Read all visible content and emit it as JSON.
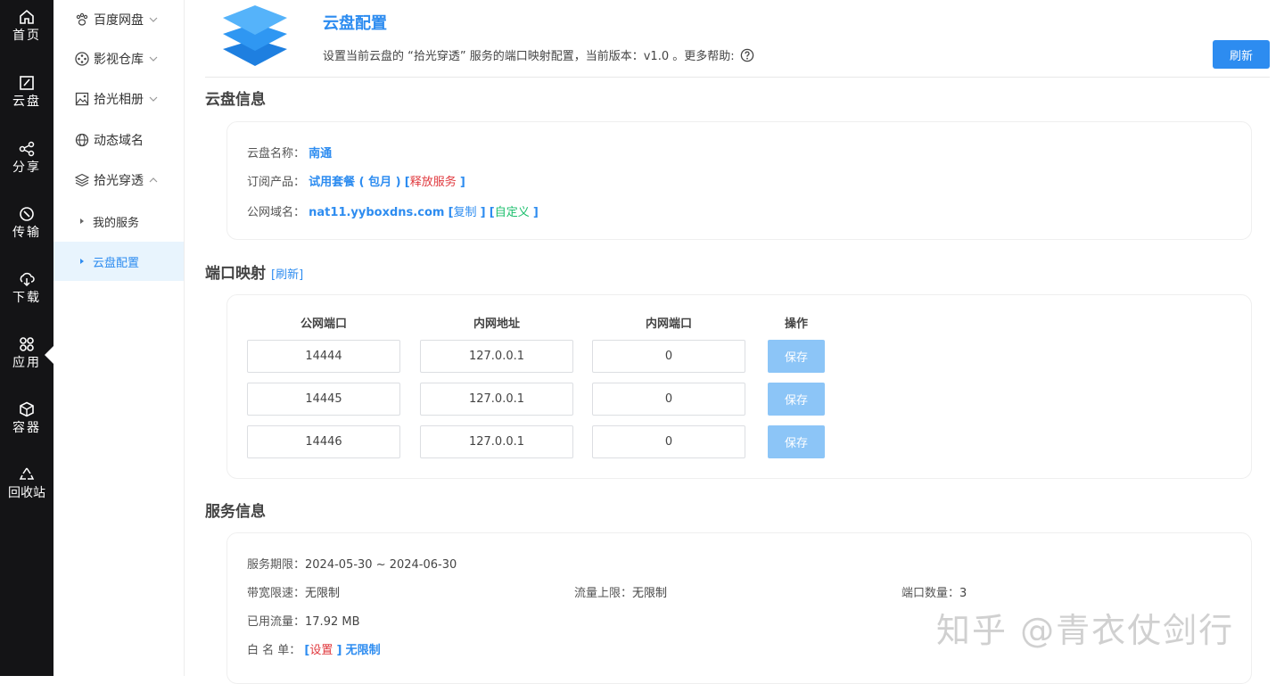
{
  "rail": {
    "items": [
      {
        "label": "首页",
        "icon": "home-icon"
      },
      {
        "label": "云盘",
        "icon": "disk-icon"
      },
      {
        "label": "分享",
        "icon": "share-icon"
      },
      {
        "label": "传输",
        "icon": "transfer-icon"
      },
      {
        "label": "下载",
        "icon": "download-icon"
      },
      {
        "label": "应用",
        "icon": "apps-icon"
      },
      {
        "label": "容器",
        "icon": "container-icon"
      },
      {
        "label": "回收站",
        "icon": "recycle-icon"
      }
    ]
  },
  "nav2": {
    "items": [
      {
        "label": "百度网盘",
        "icon": "paw-icon"
      },
      {
        "label": "影视仓库",
        "icon": "film-reel-icon"
      },
      {
        "label": "拾光相册",
        "icon": "image-icon"
      },
      {
        "label": "动态域名",
        "icon": "globe-icon"
      },
      {
        "label": "拾光穿透",
        "icon": "layers-icon"
      }
    ],
    "sub_items": [
      {
        "label": "我的服务"
      },
      {
        "label": "云盘配置"
      }
    ]
  },
  "header": {
    "title": "云盘配置",
    "desc": "设置当前云盘的 “拾光穿透” 服务的端口映射配置，当前版本：v1.0 。更多帮助:",
    "refresh_label": "刷新"
  },
  "disk_info": {
    "section_title": "云盘信息",
    "name_label": "云盘名称：",
    "name_value": "南通",
    "product_label": "订阅产品：",
    "product_value": "试用套餐 ( 包月 )",
    "release_open": "[",
    "release_text": "释放服务",
    "release_close": "]",
    "domain_label": "公网域名：",
    "domain_value": "nat11.yyboxdns.com",
    "copy_open": "[",
    "copy_text": "复制",
    "copy_close": "]",
    "custom_open": "[",
    "custom_text": "自定义",
    "custom_close": "]"
  },
  "port_mapping": {
    "section_title": "端口映射",
    "refresh_link": "[刷新]",
    "headers": [
      "公网端口",
      "内网地址",
      "内网端口",
      "操作"
    ],
    "save_label": "保存",
    "rows": [
      {
        "public_port": "14444",
        "internal_addr": "127.0.0.1",
        "internal_port": "0"
      },
      {
        "public_port": "14445",
        "internal_addr": "127.0.0.1",
        "internal_port": "0"
      },
      {
        "public_port": "14446",
        "internal_addr": "127.0.0.1",
        "internal_port": "0"
      }
    ]
  },
  "service_info": {
    "section_title": "服务信息",
    "period_label": "服务期限：",
    "period_value": "2024-05-30 ~ 2024-06-30",
    "bandwidth_label": "带宽限速：",
    "bandwidth_value": "无限制",
    "traffic_limit_label": "流量上限：",
    "traffic_limit_value": "无限制",
    "port_count_label": "端口数量：",
    "port_count_value": "3",
    "used_traffic_label": "已用流量：",
    "used_traffic_value": "17.92 MB",
    "whitelist_label": "白 名 单：",
    "whitelist_open": "[",
    "whitelist_set": "设置",
    "whitelist_close": "]",
    "whitelist_value": "无限制"
  },
  "watermark": "知乎 @青衣仗剑行",
  "colors": {
    "accent": "#2d8cf0",
    "danger": "#e0393e",
    "success": "#19be6b",
    "rail_bg": "#141416"
  }
}
